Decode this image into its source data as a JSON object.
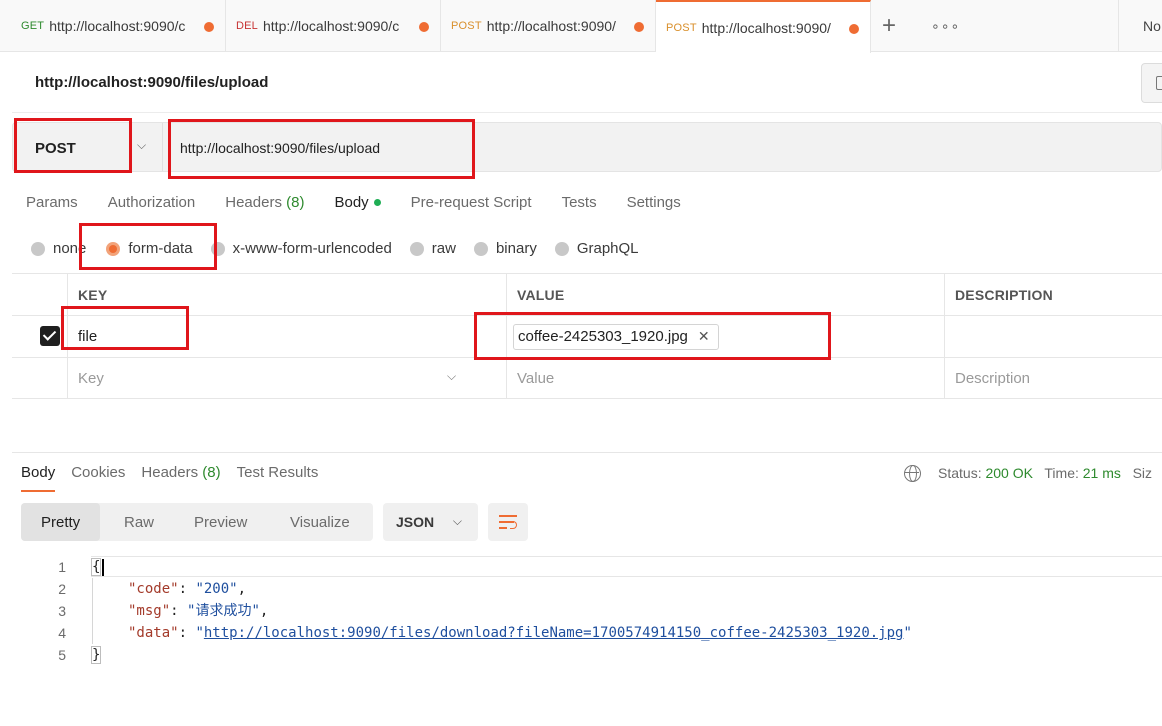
{
  "tabs": [
    {
      "method": "GET",
      "url": "http://localhost:9090/c"
    },
    {
      "method": "DEL",
      "url": "http://localhost:9090/c"
    },
    {
      "method": "POST",
      "url": "http://localhost:9090/"
    },
    {
      "method": "POST",
      "url": "http://localhost:9090/"
    }
  ],
  "tabbar": {
    "add": "+",
    "more": "∘∘∘",
    "environment": "No"
  },
  "request": {
    "title": "http://localhost:9090/files/upload",
    "method": "POST",
    "url": "http://localhost:9090/files/upload"
  },
  "request_tabs": {
    "params": "Params",
    "authorization": "Authorization",
    "headers": "Headers",
    "headers_count": "(8)",
    "body": "Body",
    "prerequest": "Pre-request Script",
    "tests": "Tests",
    "settings": "Settings"
  },
  "body_types": {
    "none": "none",
    "form_data": "form-data",
    "urlencoded": "x-www-form-urlencoded",
    "raw": "raw",
    "binary": "binary",
    "graphql": "GraphQL"
  },
  "params_table": {
    "headers": {
      "key": "KEY",
      "value": "VALUE",
      "description": "DESCRIPTION"
    },
    "row": {
      "key": "file",
      "value": "coffee-2425303_1920.jpg"
    },
    "placeholders": {
      "key": "Key",
      "value": "Value",
      "description": "Description"
    }
  },
  "response": {
    "tabs": {
      "body": "Body",
      "cookies": "Cookies",
      "headers": "Headers",
      "headers_count": "(8)",
      "test_results": "Test Results"
    },
    "status_label": "Status:",
    "status_value": "200 OK",
    "time_label": "Time:",
    "time_value": "21 ms",
    "size_label": "Siz",
    "views": {
      "pretty": "Pretty",
      "raw": "Raw",
      "preview": "Preview",
      "visualize": "Visualize"
    },
    "format": "JSON",
    "lines": {
      "n1": "1",
      "n2": "2",
      "n3": "3",
      "n4": "4",
      "n5": "5",
      "open": "{",
      "code_key": "\"code\"",
      "code_val": "\"200\"",
      "msg_key": "\"msg\"",
      "msg_val": "\"请求成功\"",
      "data_key": "\"data\"",
      "data_url": "http://localhost:9090/files/download?fileName=1700574914150_coffee-2425303_1920.jpg",
      "close": "}"
    }
  },
  "colors": {
    "accent": "#ef6c33",
    "annotation": "#e0161b",
    "success": "#2e8a2e"
  }
}
